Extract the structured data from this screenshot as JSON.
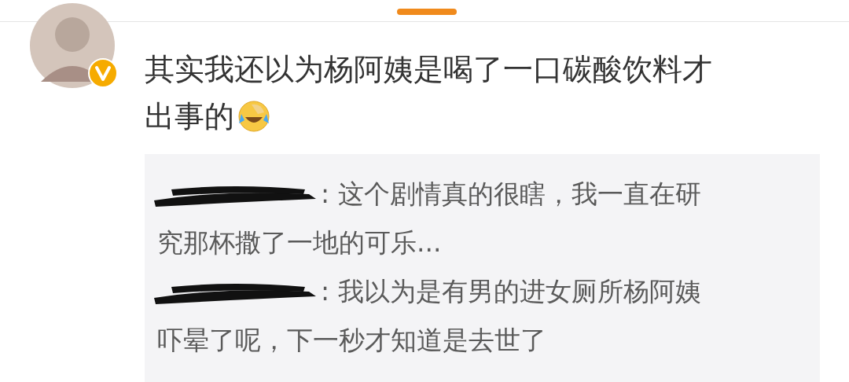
{
  "comment": {
    "avatar": {
      "verified": true
    },
    "lines": [
      "其实我还以为杨阿姨是喝了一口碳酸饮料才",
      "出事的"
    ]
  },
  "replies": [
    {
      "lines": [
        ": 这个剧情真的很瞎，我一直在研",
        "究那杯撒了一地的可乐..."
      ]
    },
    {
      "lines": [
        ": 我以为是有男的进女厕所杨阿姨",
        "吓晕了呢，下一秒才知道是去世了"
      ]
    }
  ]
}
